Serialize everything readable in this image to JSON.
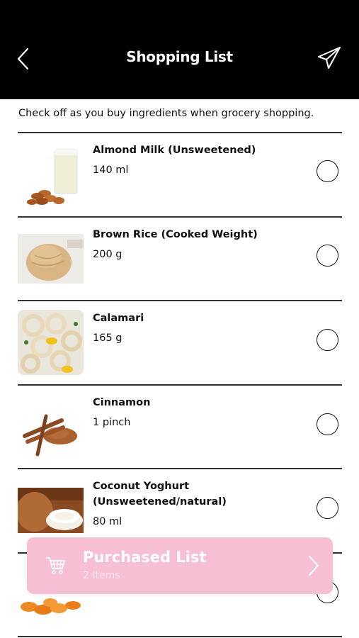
{
  "header": {
    "title": "Shopping List"
  },
  "intro": "Check off as you buy ingredients when grocery shopping.",
  "items": [
    {
      "name": "Almond Milk (Unsweetened)",
      "qty": "140 ml",
      "checked": false
    },
    {
      "name": "Brown Rice (Cooked Weight)",
      "qty": "200 g",
      "checked": false
    },
    {
      "name": "Calamari",
      "qty": "165 g",
      "checked": false
    },
    {
      "name": "Cinnamon",
      "qty": "1 pinch",
      "checked": false
    },
    {
      "name": "Coconut Yoghurt (Unsweetened/natural)",
      "qty": "80 ml",
      "checked": false
    }
  ],
  "purchased": {
    "title": "Purchased List",
    "count": "2 Items"
  },
  "colors": {
    "header_bg": "#000000",
    "purchased_bg": "#f7bfd3",
    "text": "#111111"
  }
}
